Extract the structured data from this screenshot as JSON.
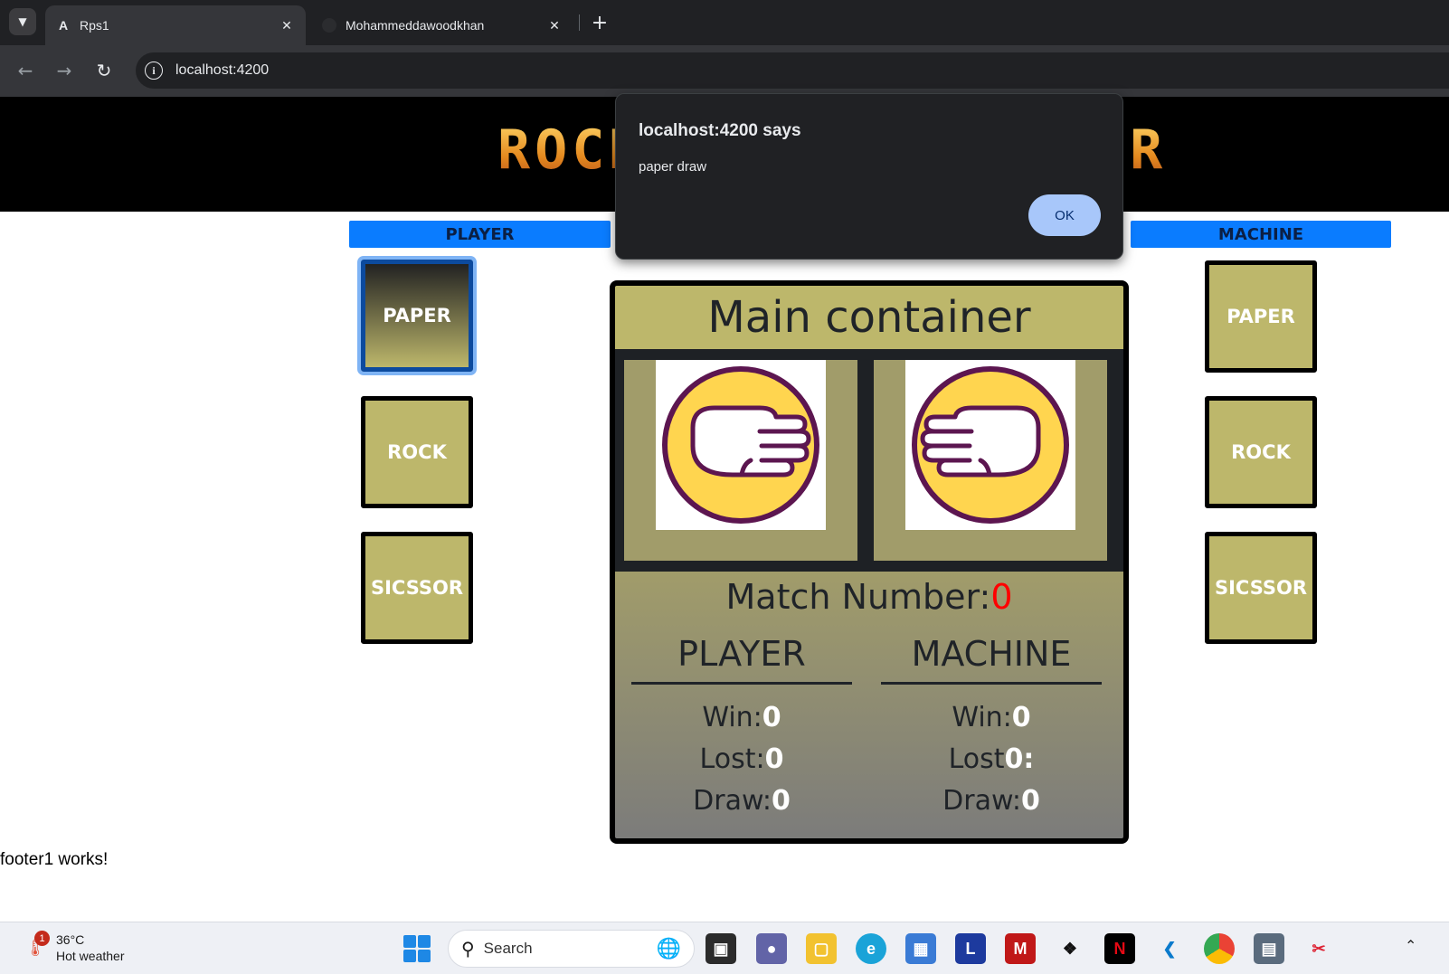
{
  "browser": {
    "tabs": [
      {
        "title": "Rps1",
        "favicon": "angular-icon",
        "active": true
      },
      {
        "title": "Mohammeddawoodkhan",
        "favicon": "github-icon",
        "active": false
      }
    ],
    "new_tab": "+",
    "url": "localhost:4200"
  },
  "banner": {
    "title": "ROCK PAPER SCISSOR"
  },
  "player": {
    "header": "PLAYER",
    "choices": [
      "PAPER",
      "ROCK",
      "SICSSOR"
    ],
    "selected": "PAPER"
  },
  "machine": {
    "header": "MACHINE",
    "choices": [
      "PAPER",
      "ROCK",
      "SICSSOR"
    ]
  },
  "main": {
    "title": "Main container",
    "player_hand": "paper-hand-icon",
    "machine_hand": "paper-hand-icon",
    "match_label": "Match Number:",
    "match_number": "0",
    "player_col": {
      "title": "PLAYER",
      "win_label": "Win:",
      "win": "0",
      "lost_label": "Lost:",
      "lost": "0",
      "draw_label": "Draw:",
      "draw": "0"
    },
    "machine_col": {
      "title": "MACHINE",
      "win_label": "Win:",
      "win": "0",
      "lost_label": "Lost",
      "lost": "0:",
      "draw_label": "Draw:",
      "draw": "0"
    }
  },
  "footer": "footer1 works!",
  "dialog": {
    "title": "localhost:4200 says",
    "message": "paper draw",
    "ok": "OK"
  },
  "taskbar": {
    "weather_badge": "1",
    "temperature": "36°C",
    "condition": "Hot weather",
    "search_placeholder": "Search",
    "apps": [
      "task-view-icon",
      "teams-icon",
      "file-explorer-icon",
      "edge-icon",
      "store-icon",
      "l-app-icon",
      "mcafee-icon",
      "dropbox-icon",
      "netflix-icon",
      "vscode-icon",
      "chrome-icon",
      "remote-desktop-icon",
      "snipping-tool-icon"
    ]
  },
  "colors": {
    "accent_blue": "#0a7cff",
    "tile": "#bdb76b",
    "dialog_button": "#a8c7fa",
    "match_number": "#ff0000"
  }
}
